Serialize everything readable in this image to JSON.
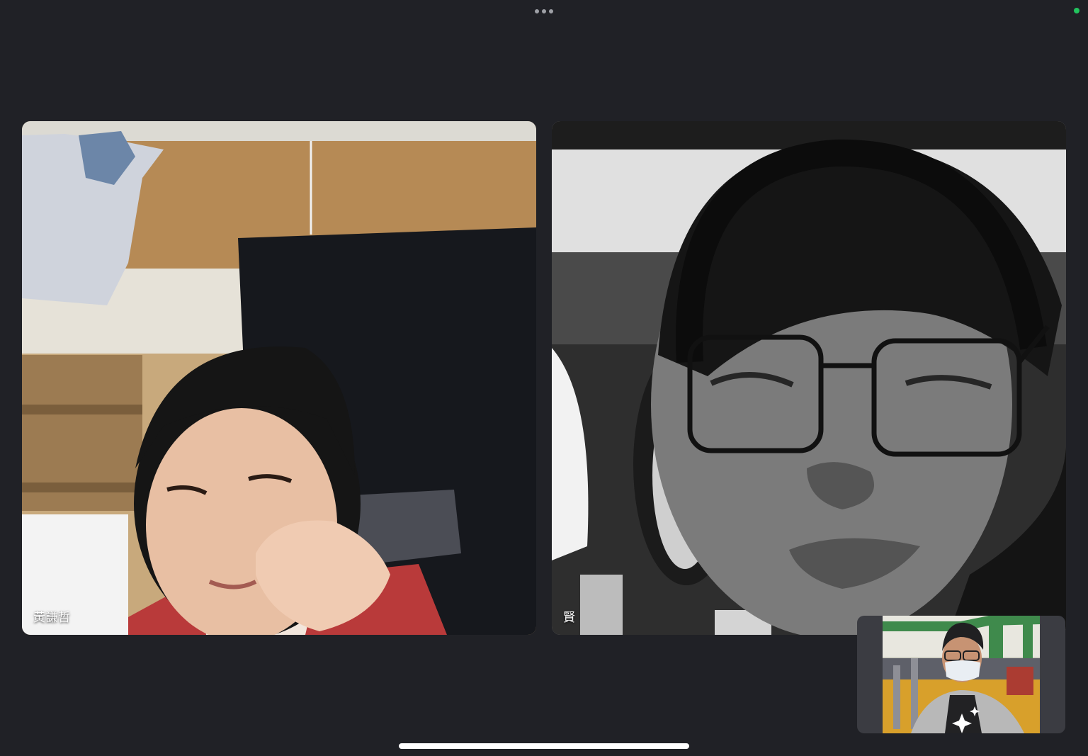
{
  "call": {
    "participants": [
      {
        "name": "黃謙哲"
      },
      {
        "name": "賢"
      }
    ]
  },
  "indicators": {
    "more_icon": "ellipsis-icon",
    "privacy_dot_color": "#22c45e",
    "effects_icon": "sparkles-icon"
  }
}
